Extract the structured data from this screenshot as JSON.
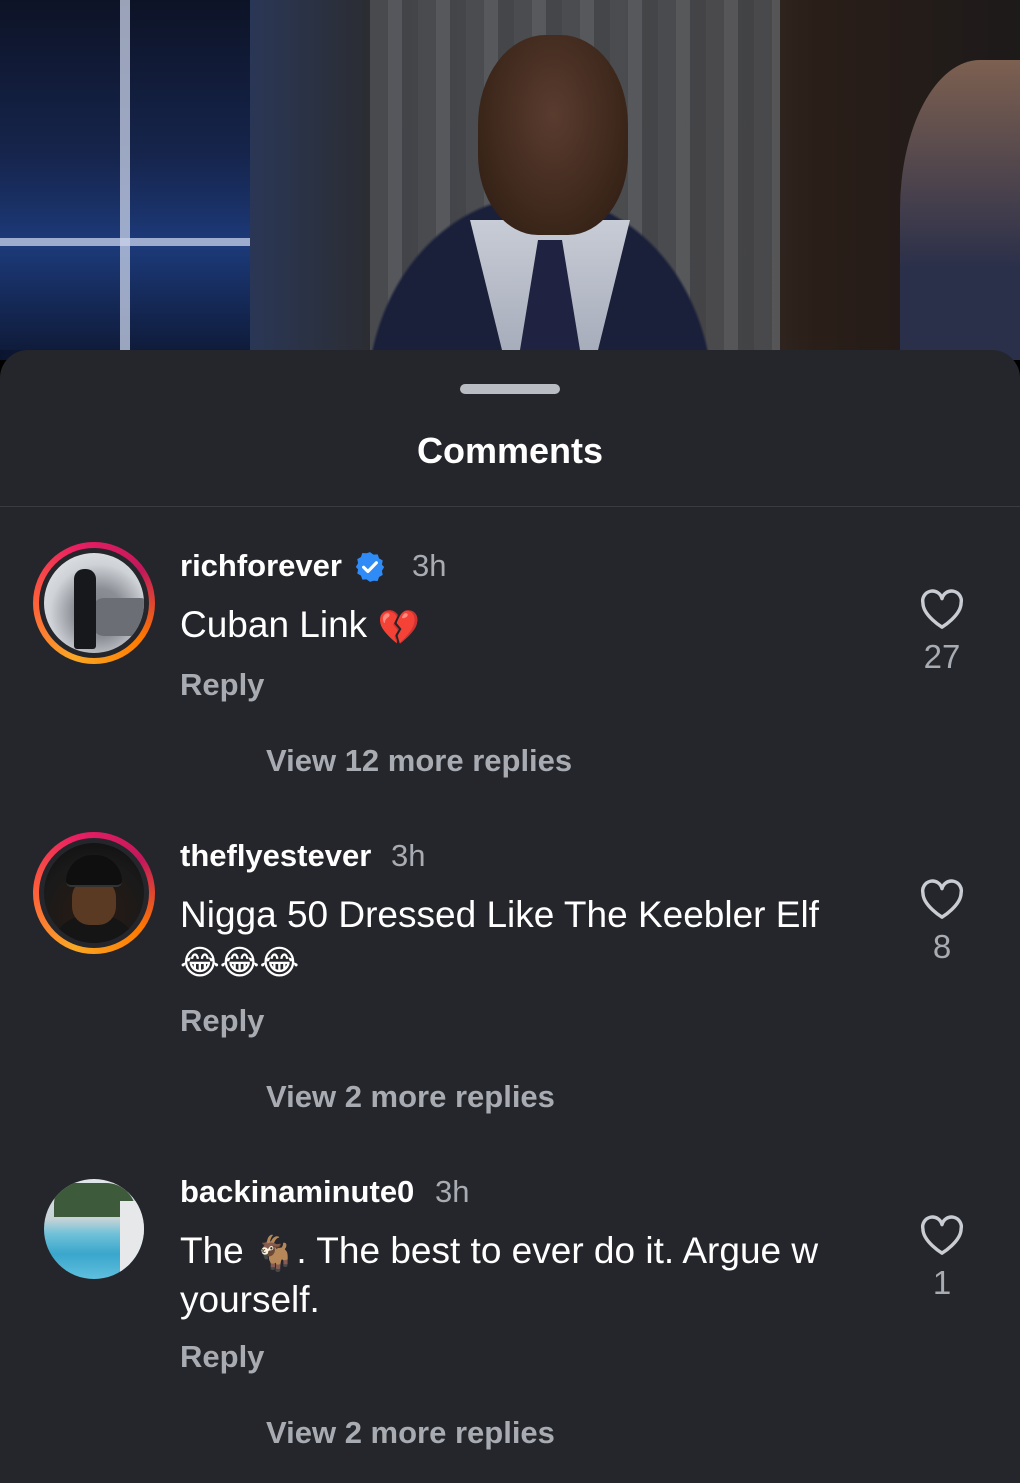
{
  "sheet": {
    "title": "Comments"
  },
  "icons": {
    "verified": "verified-badge-icon",
    "like": "heart-outline-icon"
  },
  "colors": {
    "sheet_bg": "#25262b",
    "muted_text": "#a8abb2",
    "verified": "#2f8cf7",
    "ring_start": "#f9a825",
    "ring_end": "#e91e63"
  },
  "comments": [
    {
      "username": "richforever",
      "verified": true,
      "time": "3h",
      "text": "Cuban Link",
      "emoji": "💔",
      "reply_label": "Reply",
      "likes": "27",
      "view_replies": "View 12 more replies"
    },
    {
      "username": "theflyestever",
      "verified": false,
      "time": "3h",
      "text": "Nigga 50 Dressed Like The Keebler Elf",
      "emoji": "😂😂😂",
      "reply_label": "Reply",
      "likes": "8",
      "view_replies": "View 2 more replies"
    },
    {
      "username": "backinaminute0",
      "verified": false,
      "time": "3h",
      "text_before": "The",
      "emoji": "🐐",
      "text_after": ". The best to ever do it. Argue w yourself.",
      "reply_label": "Reply",
      "likes": "1",
      "view_replies": "View 2 more replies"
    }
  ]
}
